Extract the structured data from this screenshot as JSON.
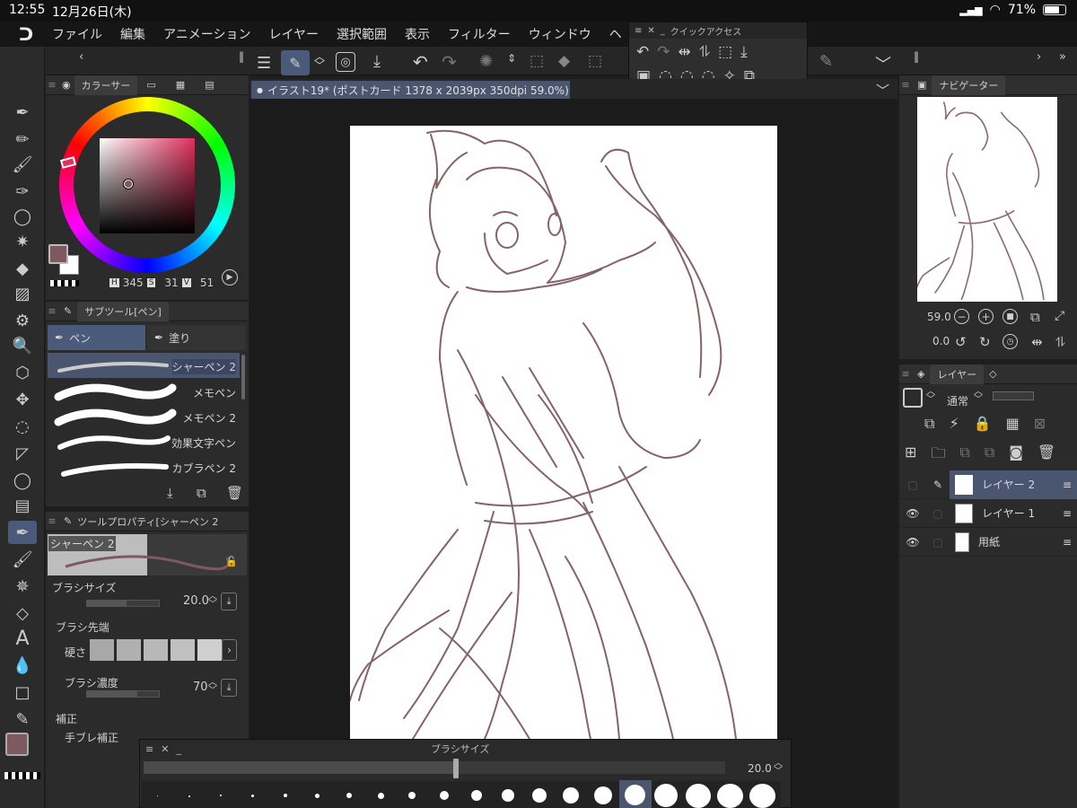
{
  "status": {
    "time": "12:55",
    "date": "12月26日(木)",
    "battery": "71%"
  },
  "menu": {
    "logo": "ᑐ",
    "items": [
      "ファイル",
      "編集",
      "アニメーション",
      "レイヤー",
      "選択範囲",
      "表示",
      "フィルター",
      "ウィンドウ",
      "ヘ"
    ]
  },
  "quick_access": {
    "title": "クイックアクセス"
  },
  "document": {
    "tab_title": "イラスト19* (ポストカード 1378 x 2039px 350dpi 59.0%)"
  },
  "color_panel": {
    "title": "カラーサー",
    "hsv": {
      "h_label": "H",
      "h": "345",
      "s_label": "S",
      "s": "31",
      "v_label": "V",
      "v": "51"
    },
    "main_color": "#7d5a62",
    "sub_color": "#ffffff"
  },
  "subtool_panel": {
    "title": "サブツール[ペン]",
    "tabs": [
      "ペン",
      "塗り"
    ],
    "items": [
      "シャーペン 2",
      "メモペン",
      "メモペン 2",
      "効果文字ペン",
      "カブラペン 2"
    ]
  },
  "tool_property": {
    "title": "ツールプロパティ[シャーペン 2",
    "preview_name": "シャーペン 2",
    "brush_size_label": "ブラシサイズ",
    "brush_size": "20.0",
    "brush_tip_label": "ブラシ先端",
    "hardness_label": "硬さ",
    "density_label": "ブラシ濃度",
    "density": "70",
    "correction_label": "補正",
    "stabilization_label": "手ブレ補正"
  },
  "navigator": {
    "title": "ナビゲーター",
    "zoom": "59.0",
    "rotation": "0.0"
  },
  "layer_panel": {
    "title": "レイヤー",
    "blend_mode": "通常",
    "layers": [
      {
        "name": "レイヤー 2",
        "visible": false,
        "selected": true
      },
      {
        "name": "レイヤー 1",
        "visible": true,
        "selected": false
      },
      {
        "name": "用紙",
        "visible": true,
        "selected": false
      }
    ]
  },
  "brush_size_palette": {
    "title": "ブラシサイズ",
    "value": "20.0"
  }
}
